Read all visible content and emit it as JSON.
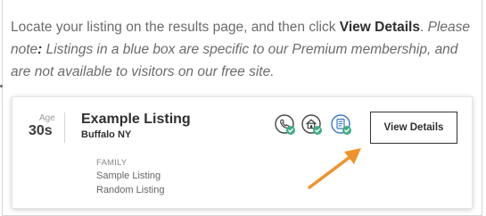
{
  "instructions": {
    "part1": "Locate your listing on the results page, and then click ",
    "bold_action": "View Details",
    "part2": ". ",
    "note_lead": "Please note",
    "note_colon": ":",
    "note_body": " Listings in a blue box are specific to our Premium membership, and are not available to visitors on our free site."
  },
  "listing": {
    "age_label": "Age",
    "age_value": "30s",
    "title": "Example Listing",
    "location": "Buffalo NY",
    "category": "FAMILY",
    "sub_items": [
      "Sample Listing",
      "Random Listing"
    ],
    "icons": [
      "phone-check-icon",
      "home-check-icon",
      "document-check-icon"
    ],
    "view_button": "View Details"
  },
  "colors": {
    "accent_check": "#3fae86",
    "arrow": "#f0932b",
    "doc_icon": "#3b78c4"
  }
}
